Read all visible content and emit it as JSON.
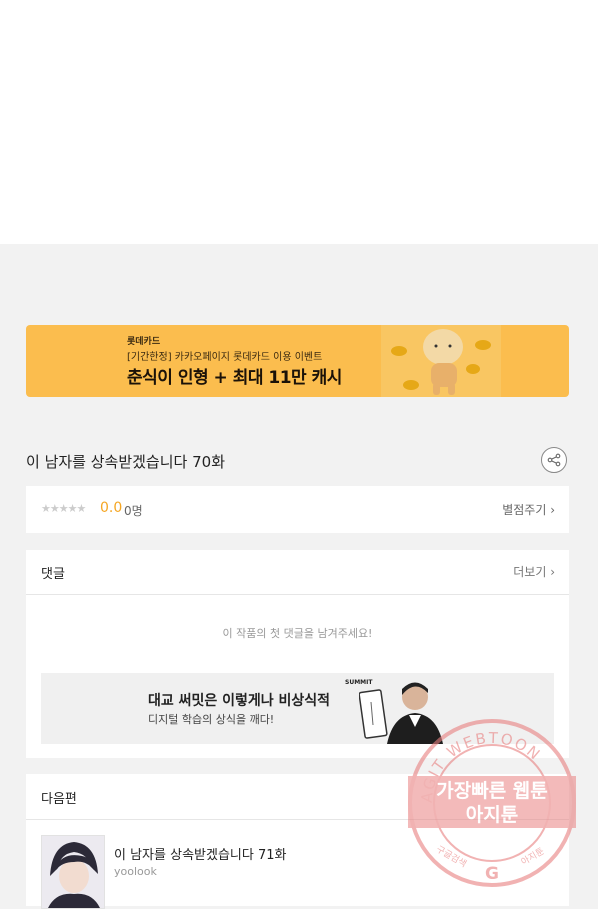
{
  "banner": {
    "brand": "롯데카드",
    "subtitle": "[기간한정] 카카오페이지 롯데카드 이용 이벤트",
    "headline": "춘식이 인형 + 최대 11만 캐시"
  },
  "episode": {
    "title": "이 남자를 상속받겠습니다 70화"
  },
  "rating": {
    "stars": "★★★★★",
    "score": "0.0",
    "count": "0명",
    "button": "별점주기 ›",
    "star_fraction": 0
  },
  "comments": {
    "title": "댓글",
    "more": "더보기 ›",
    "empty_message": "이 작품의 첫 댓글을 남겨주세요!"
  },
  "ad": {
    "headline": "대교 써밋은 이렇게나 비상식적",
    "sub": "디지털 학습의 상식을 깨다!",
    "logo": "SUMMIT"
  },
  "next": {
    "title": "다음편",
    "episode_title": "이 남자를 상속받겠습니다 71화",
    "author": "yoolook"
  },
  "watermark": {
    "ring_text": "AGIT WEBTOON",
    "line1": "가장빠른 웹툰",
    "line2": "아지툰",
    "bottom_left": "구글검색",
    "bottom_right": "아지툰",
    "color": "#e88080"
  },
  "colors": {
    "accent": "#f5a623",
    "banner_bg": "#fbbd4e"
  }
}
